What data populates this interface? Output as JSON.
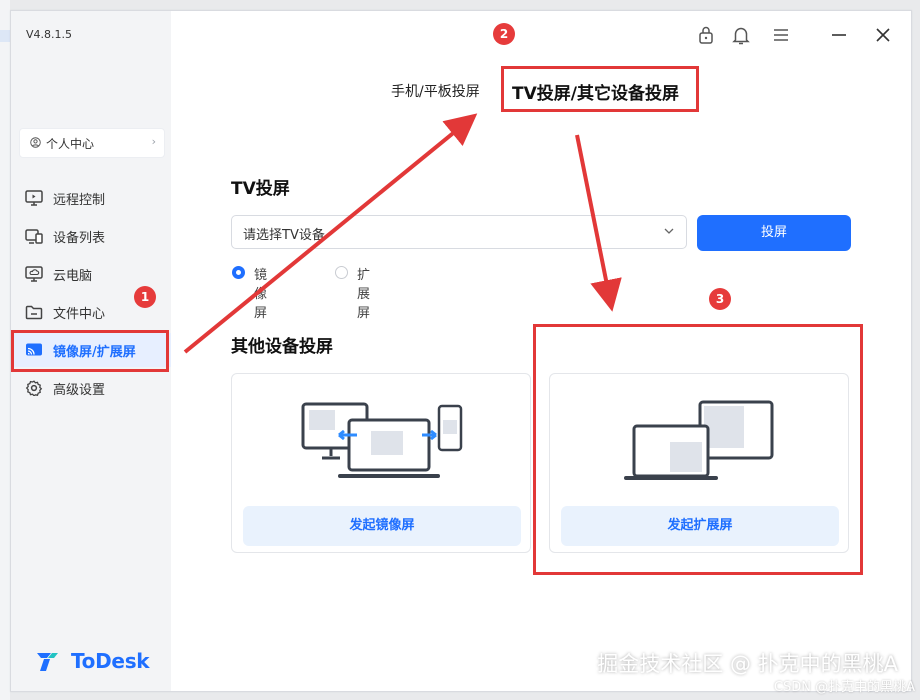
{
  "app": {
    "version": "V4.8.1.5",
    "logo_text": "ToDesk"
  },
  "sidebar": {
    "profile": {
      "label": "个人中心",
      "chevron": "›"
    },
    "items": [
      {
        "label": "远程控制",
        "icon": "monitor-icon"
      },
      {
        "label": "设备列表",
        "icon": "device-list-icon"
      },
      {
        "label": "云电脑",
        "icon": "cloud-pc-icon"
      },
      {
        "label": "文件中心",
        "icon": "folder-icon"
      },
      {
        "label": "镜像屏/扩展屏",
        "icon": "cast-screen-icon",
        "active": true
      },
      {
        "label": "高级设置",
        "icon": "gear-icon"
      }
    ]
  },
  "titlebar": {
    "icons": [
      "lock-icon",
      "bell-icon",
      "menu-icon",
      "minimize-icon",
      "close-icon"
    ]
  },
  "tabs": [
    {
      "label": "手机/平板投屏"
    },
    {
      "label": "TV投屏/其它设备投屏",
      "active": true
    }
  ],
  "tv": {
    "heading": "TV投屏",
    "select_placeholder": "请选择TV设备",
    "cast_button": "投屏",
    "options": [
      {
        "label": "镜像屏",
        "selected": true
      },
      {
        "label": "扩展屏",
        "selected": false
      }
    ]
  },
  "other": {
    "heading": "其他设备投屏",
    "mirror_button": "发起镜像屏",
    "extend_button": "发起扩展屏"
  },
  "annotations": [
    "1",
    "2",
    "3"
  ],
  "watermark": {
    "main": "掘金技术社区 @ 扑克中的黑桃A",
    "sub": "CSDN @扑克中的黑桃A"
  },
  "colors": {
    "accent": "#1f6fff",
    "annotation_red": "#e23838",
    "sidebar_bg": "#f3f4f6"
  }
}
